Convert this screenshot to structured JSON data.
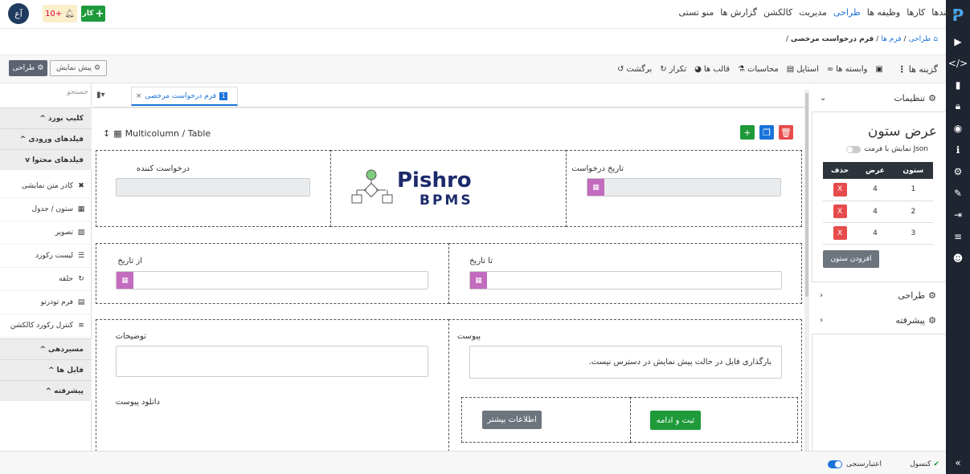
{
  "colors": {
    "accent": "#1a73d9",
    "success": "#1e9a3a",
    "danger": "#e74c4c",
    "dark": "#1e2430",
    "calendar": "#c26bbf"
  },
  "rightbar": {
    "logo": "P",
    "icons": [
      "play-icon",
      "code-icon",
      "file-icon",
      "lock-icon",
      "target-icon",
      "info-icon",
      "gear-icon",
      "magic-icon",
      "file-export-icon",
      "database-icon",
      "robot-icon"
    ],
    "collapse_icon": "double-chevron-left-icon"
  },
  "topnav": {
    "items": [
      "فرایندها",
      "کارها",
      "وظیفه ها",
      "طراحی",
      "مدیریت",
      "کالکشن",
      "گزارش ها",
      "منو تستی"
    ],
    "active": "طراحی"
  },
  "avatar": "آع",
  "notification": {
    "count": "10+"
  },
  "new_task": "کار",
  "breadcrumb": {
    "parts": [
      "طراحی",
      "فرم ها",
      "فرم درخواست مرخصی"
    ],
    "sep": "/"
  },
  "toolbar": {
    "options": "گزینه ها",
    "dependencies": "وابسته ها",
    "style": "استایل",
    "calculations": "محاسبات",
    "templates": "قالب ها",
    "repeat": "تکرار",
    "undo": "برگشت",
    "preview": "پیش نمایش",
    "design": "طراحی"
  },
  "palette": {
    "search_placeholder": "جستجو",
    "clipboard": "کلیپ بورد",
    "input_fields": "فیلدهای ورودی",
    "content_fields": "فیلدهای محتوا",
    "items": [
      "کادر متن نمایشی",
      "ستون / جدول",
      "تصویر",
      "لیست رکورد",
      "حلقه",
      "فرم تودرتو",
      "کنترل رکورد کالکشن"
    ],
    "routing": "مسیردهی",
    "files": "فایل ها",
    "advanced": "پیشرفته"
  },
  "form_tab": {
    "number": "1",
    "label": "فرم درخواست مرخصی",
    "close": "×"
  },
  "component": {
    "title": "Multicolumn / Table"
  },
  "form": {
    "requester": "درخواست کننده",
    "logo_text": "Pishro",
    "logo_sub": "BPMS",
    "request_date": "تاریخ درخواست",
    "from_date": "از تاریخ",
    "to_date": "تا تاریخ",
    "description": "توضیحات",
    "attachment": "پیوست",
    "attachment_msg": "بارگذاری فایل در حالت پیش نمایش در دسترس نیست.",
    "download_attachment": "دانلود پیوست",
    "more_info": "اطلاعات بیشتر",
    "submit": "ثبت و ادامه"
  },
  "settings": {
    "title": "تنظیمات",
    "column_width": "عرض ستون",
    "json_toggle": "Json نمایش با فرمت",
    "headers": {
      "column": "ستون",
      "width": "عرض",
      "delete": "حذف"
    },
    "rows": [
      {
        "column": "1",
        "width": "4"
      },
      {
        "column": "2",
        "width": "4"
      },
      {
        "column": "3",
        "width": "4"
      }
    ],
    "delete_label": "X",
    "add_column": "افزودن ستون",
    "design": "طراحی",
    "advanced": "پیشرفته"
  },
  "statusbar": {
    "console": "کنسول",
    "validation": "اعتبارسنجی"
  }
}
